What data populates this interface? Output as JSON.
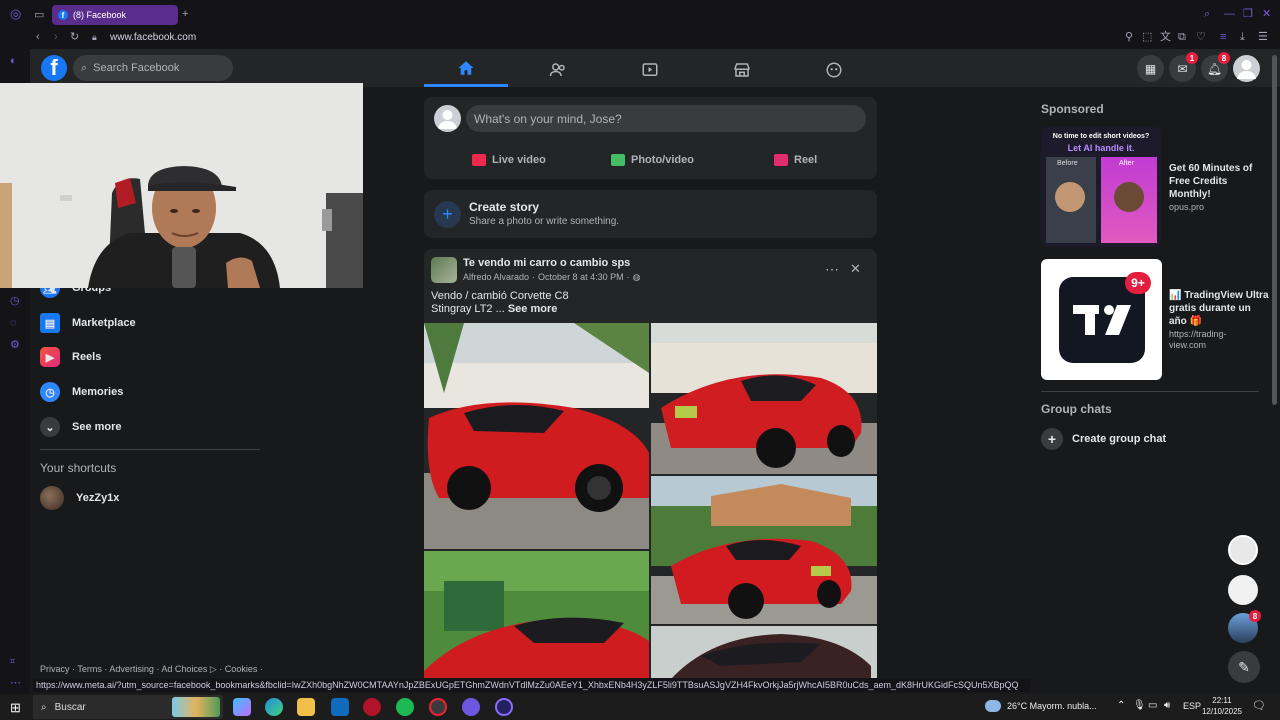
{
  "browser": {
    "tab_title": "(8) Facebook",
    "address": "www.facebook.com",
    "status_url": "https://www.meta.ai/?utm_source=facebook_bookmarks&fbclid=IwZXh0bgNhZW0CMTAAYnJpZBExUGpETGhmZWdnVTdlMzZu0AEeY1_XhbxENb4H3yZLF5li9TTBsuASJgVZH4FkvOrkjJa5rjWhcAI5BR0uCds_aem_dK8HrUKGidFcSQUn5XBpQQ"
  },
  "header": {
    "logo": "f",
    "search_placeholder": "Search Facebook",
    "messenger_badge": "1",
    "notifications_badge": "8"
  },
  "left_nav": {
    "items": [
      {
        "label": "Groups"
      },
      {
        "label": "Marketplace"
      },
      {
        "label": "Reels"
      },
      {
        "label": "Memories"
      },
      {
        "label": "See more"
      }
    ],
    "shortcuts_title": "Your shortcuts",
    "shortcuts": [
      {
        "label": "YezZy1x"
      }
    ],
    "footer": "Privacy · Terms · Advertising · Ad Choices ▷ · Cookies ·"
  },
  "composer": {
    "placeholder": "What's on your mind, Jose?",
    "live_video": "Live video",
    "photo_video": "Photo/video",
    "reel": "Reel"
  },
  "story": {
    "title": "Create story",
    "subtitle": "Share a photo or write something."
  },
  "post": {
    "group": "Te vendo mi carro o cambio sps",
    "author": "Alfredo Alvarado",
    "date": "October 8 at 4:30 PM",
    "line1": "Vendo / cambió Corvette C8",
    "line2": "Stingray LT2 ...",
    "see_more": "See more"
  },
  "right_rail": {
    "sponsored": "Sponsored",
    "ad1": {
      "img_line1": "No time to edit short videos?",
      "img_line2": "Let AI handle it.",
      "before": "Before",
      "after": "After",
      "title": "Get 60 Minutes of Free Credits Monthly!",
      "domain": "opus.pro"
    },
    "ad2": {
      "badge": "9+",
      "title": "📊 TradingView Ultra gratis durante un año 🎁",
      "domain": "https://trading-view.com"
    },
    "group_chats": "Group chats",
    "create_group_chat": "Create group chat",
    "contact_badge": "8"
  },
  "taskbar": {
    "search": "Buscar",
    "weather": "26°C  Mayorm. nubla...",
    "lang": "ESP",
    "time": "22:11",
    "date": "12/10/2025"
  },
  "colors": {
    "accent": "#2d88ff",
    "fb_blue": "#1877f2",
    "badge_red": "#e41e3f",
    "corvette_red": "#d01c1f"
  }
}
